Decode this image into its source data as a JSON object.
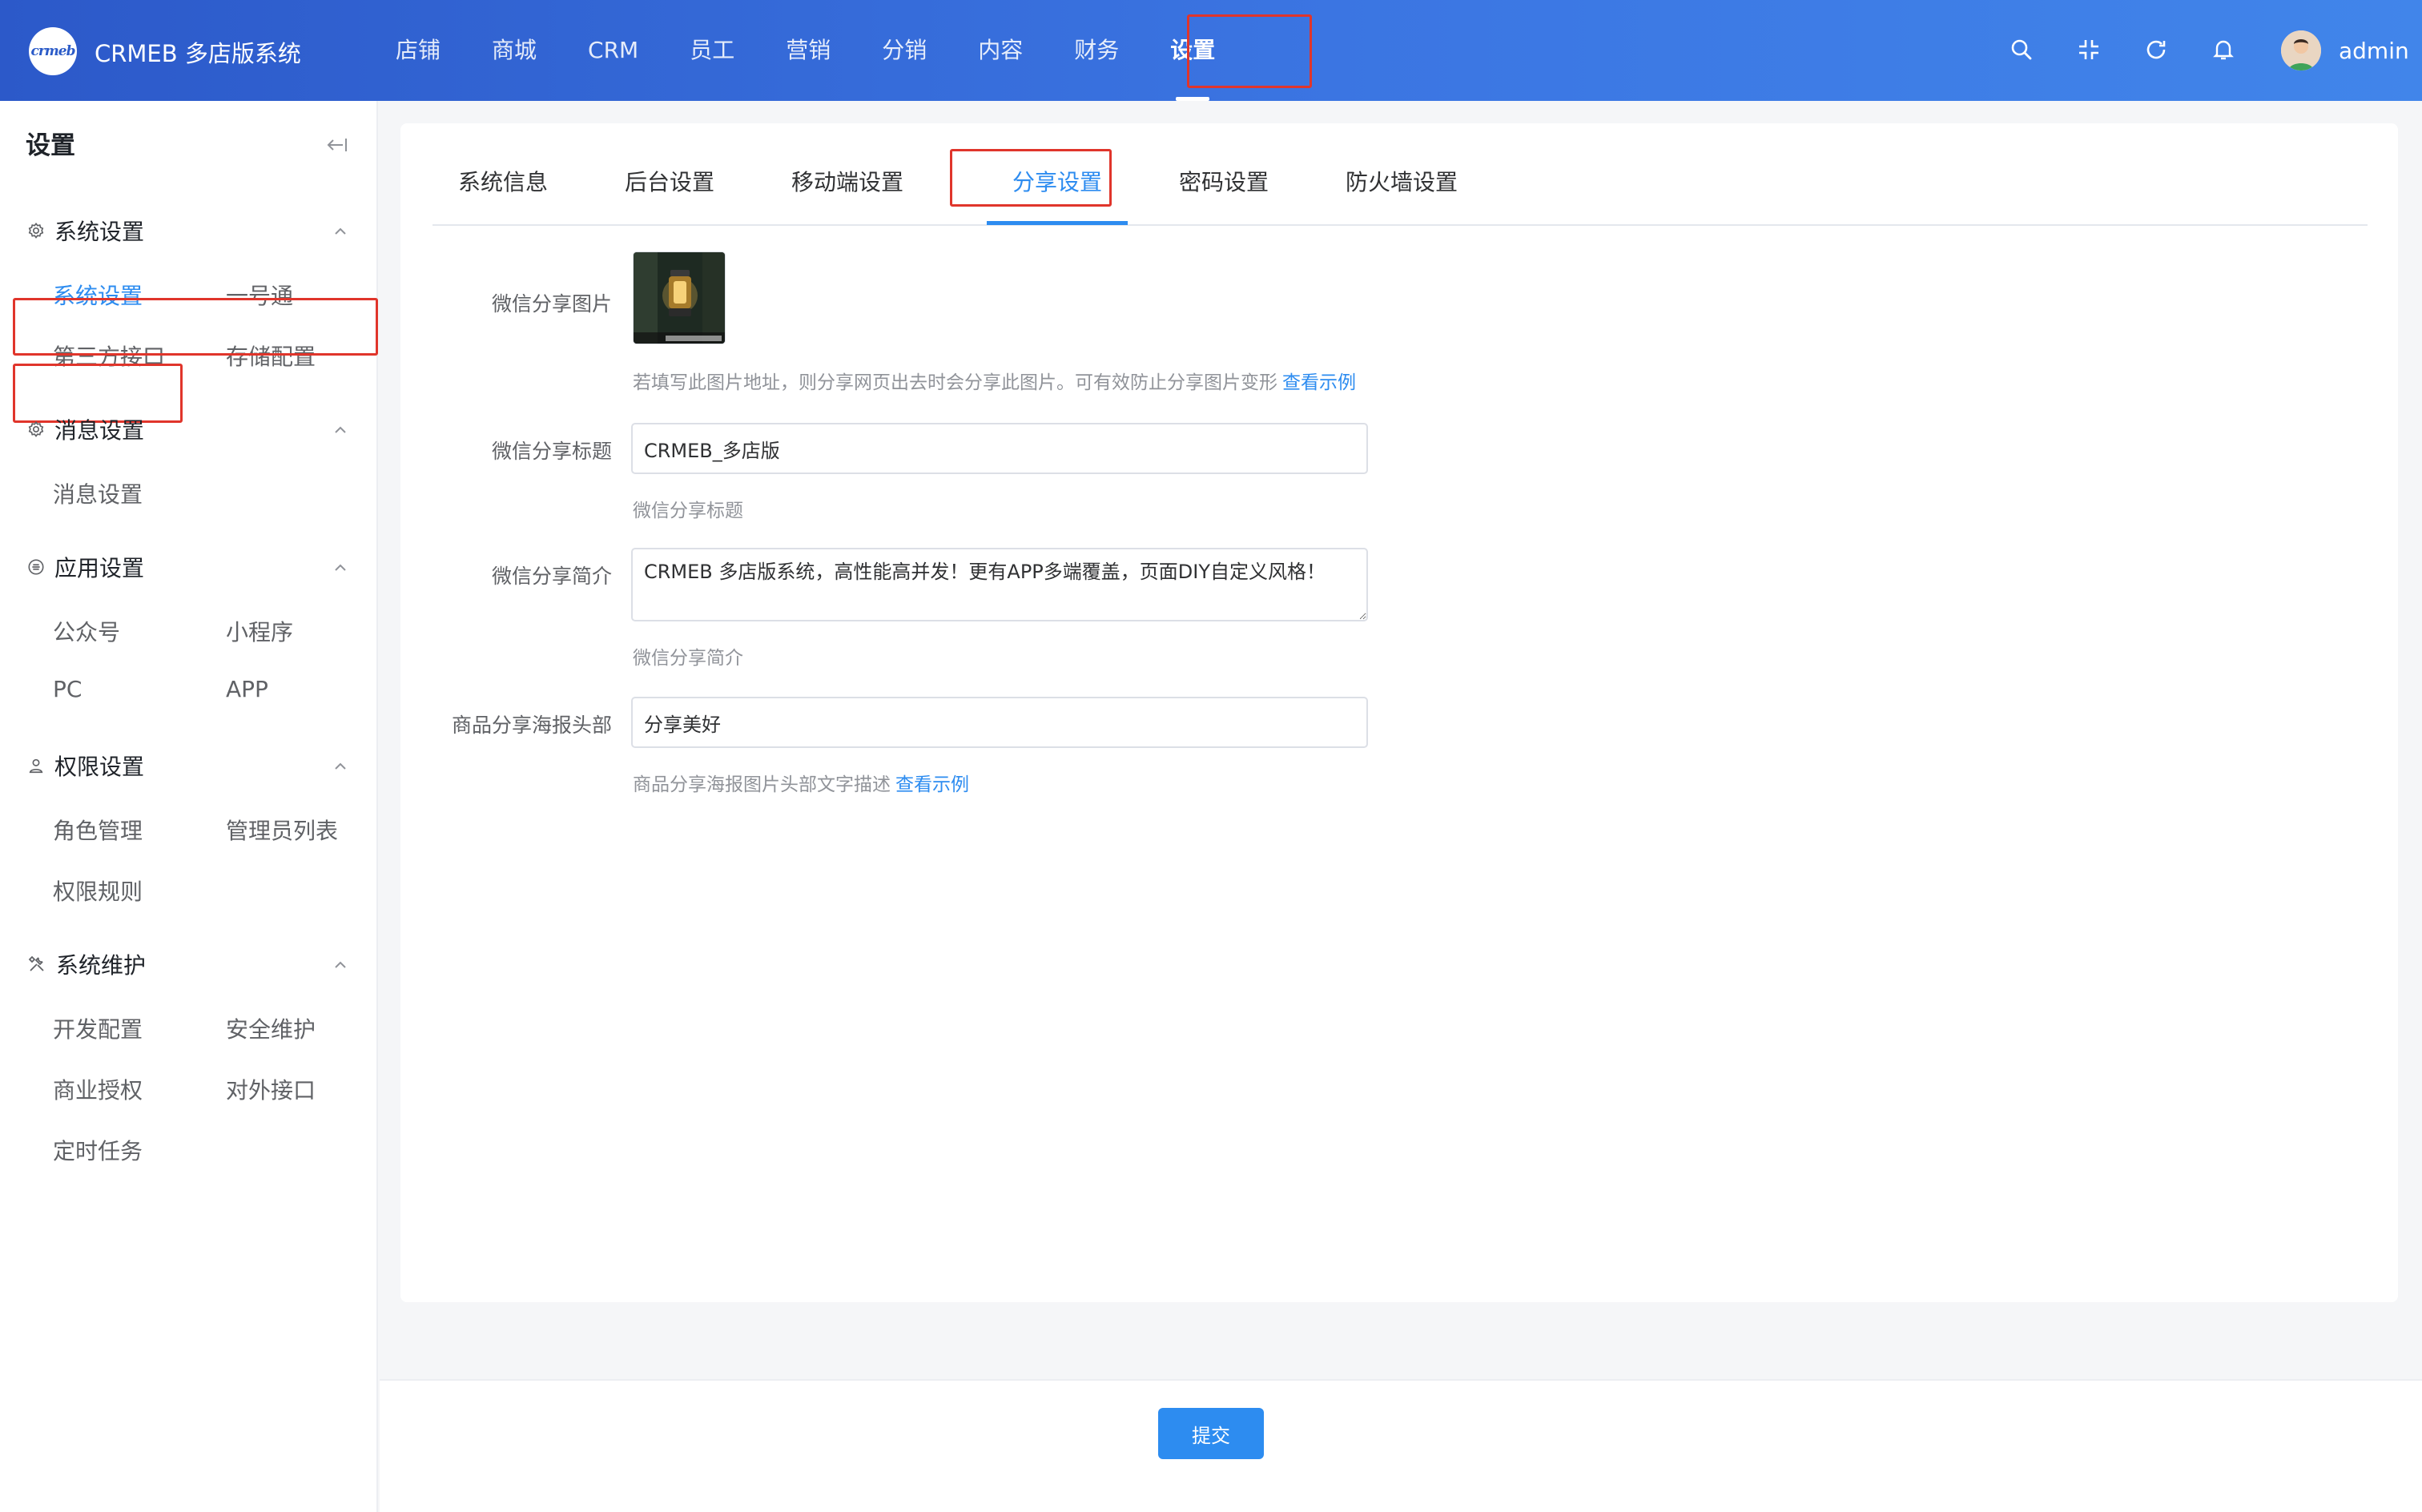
{
  "header": {
    "logo_text": "crmeb",
    "app_title": "CRMEB 多店版系统",
    "nav": [
      {
        "label": "店铺"
      },
      {
        "label": "商城"
      },
      {
        "label": "CRM"
      },
      {
        "label": "员工"
      },
      {
        "label": "营销"
      },
      {
        "label": "分销"
      },
      {
        "label": "内容"
      },
      {
        "label": "财务"
      },
      {
        "label": "设置"
      }
    ],
    "active_nav": "设置",
    "icons": [
      "search-icon",
      "fullscreen-exit-icon",
      "refresh-icon",
      "bell-icon"
    ],
    "user": {
      "name": "admin"
    }
  },
  "sidebar": {
    "title": "设置",
    "groups": [
      {
        "title": "系统设置",
        "icon": "gear-icon",
        "items": [
          "系统设置",
          "一号通",
          "第三方接口",
          "存储配置"
        ]
      },
      {
        "title": "消息设置",
        "icon": "gear-icon",
        "items": [
          "消息设置"
        ]
      },
      {
        "title": "应用设置",
        "icon": "app-icon",
        "items": [
          "公众号",
          "小程序",
          "PC",
          "APP"
        ]
      },
      {
        "title": "权限设置",
        "icon": "user-icon",
        "items": [
          "角色管理",
          "管理员列表",
          "权限规则"
        ]
      },
      {
        "title": "系统维护",
        "icon": "tools-icon",
        "items": [
          "开发配置",
          "安全维护",
          "商业授权",
          "对外接口",
          "定时任务"
        ]
      }
    ],
    "active_item": "系统设置"
  },
  "tabs": [
    "系统信息",
    "后台设置",
    "移动端设置",
    "分享设置",
    "密码设置",
    "防火墙设置"
  ],
  "active_tab": "分享设置",
  "form": {
    "share_image": {
      "label": "微信分享图片",
      "hint": "若填写此图片地址，则分享网页出去时会分享此图片。可有效防止分享图片变形",
      "hint_link": "查看示例"
    },
    "share_title": {
      "label": "微信分享标题",
      "value": "CRMEB_多店版",
      "hint": "微信分享标题"
    },
    "share_intro": {
      "label": "微信分享简介",
      "value": "CRMEB 多店版系统，高性能高并发！更有APP多端覆盖，页面DIY自定义风格！",
      "hint": "微信分享简介"
    },
    "poster_header": {
      "label": "商品分享海报头部",
      "value": "分享美好",
      "hint": "商品分享海报图片头部文字描述",
      "hint_link": "查看示例"
    }
  },
  "footer": {
    "submit_label": "提交"
  },
  "colors": {
    "primary": "#2d8cf0",
    "header_start": "#2c59c9",
    "header_end": "#4185ea",
    "annotation": "#e0352b"
  }
}
